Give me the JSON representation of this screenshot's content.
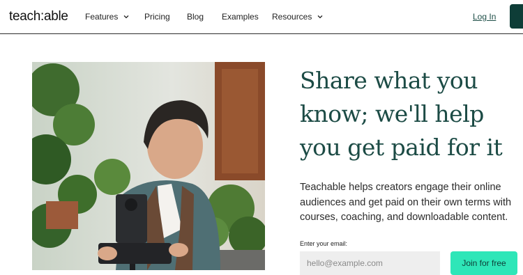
{
  "nav": {
    "logo": "teach:able",
    "items": [
      {
        "label": "Features",
        "has_dropdown": true
      },
      {
        "label": "Pricing",
        "has_dropdown": false
      },
      {
        "label": "Blog",
        "has_dropdown": false
      },
      {
        "label": "Examples",
        "has_dropdown": false
      },
      {
        "label": "Resources",
        "has_dropdown": true
      }
    ],
    "login_label": "Log In",
    "icons": {
      "dropdown": "chevron-down-icon"
    }
  },
  "hero": {
    "headline_lines": [
      "Share what you",
      "know; we'll help",
      "you get paid for it"
    ],
    "subtext": "Teachable helps creators engage their online audiences and get paid on their own terms with courses, coaching, and downloadable content.",
    "image": "photo of a man filming a bonsai plant with a camera on a tripod"
  },
  "form": {
    "email_label": "Enter your email:",
    "email_placeholder": "hello@example.com",
    "email_value": "",
    "submit_label": "Join for free"
  },
  "colors": {
    "brand_dark": "#0e3d37",
    "headline": "#1c4b45",
    "accent": "#2ee6b8"
  }
}
